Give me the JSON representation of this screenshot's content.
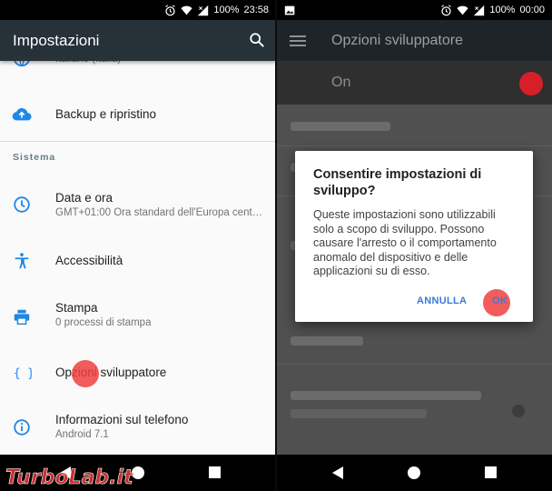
{
  "left": {
    "status": {
      "battery": "100%",
      "time": "23:58"
    },
    "appbar": {
      "title": "Impostazioni"
    },
    "items": [
      {
        "title": "",
        "subtitle": "Italiano (Italia)"
      },
      {
        "title": "Backup e ripristino",
        "subtitle": ""
      },
      {
        "title": "Data e ora",
        "subtitle": "GMT+01:00 Ora standard dell'Europa cent…"
      },
      {
        "title": "Accessibilità",
        "subtitle": ""
      },
      {
        "title": "Stampa",
        "subtitle": "0 processi di stampa"
      },
      {
        "title": "Opzioni sviluppatore",
        "subtitle": ""
      },
      {
        "title": "Informazioni sul telefono",
        "subtitle": "Android 7.1"
      }
    ],
    "section_label": "Sistema"
  },
  "right": {
    "status": {
      "battery": "100%",
      "time": "00:00"
    },
    "appbar": {
      "title": "Opzioni sviluppatore"
    },
    "master_switch_label": "On",
    "dialog": {
      "title": "Consentire impostazioni di sviluppo?",
      "message": "Queste impostazioni sono utilizzabili solo a scopo di sviluppo. Possono causare l'arresto o il comportamento anomalo del dispositivo e delle applicazioni su di esso.",
      "cancel_label": "ANNULLA",
      "ok_label": "OK"
    }
  },
  "watermark": "TurboLab.it",
  "colors": {
    "accent": "#3a7bd5",
    "appbar_dark": "#263238",
    "tap_marker": "#f0403f",
    "switch_on": "#d71f29"
  }
}
